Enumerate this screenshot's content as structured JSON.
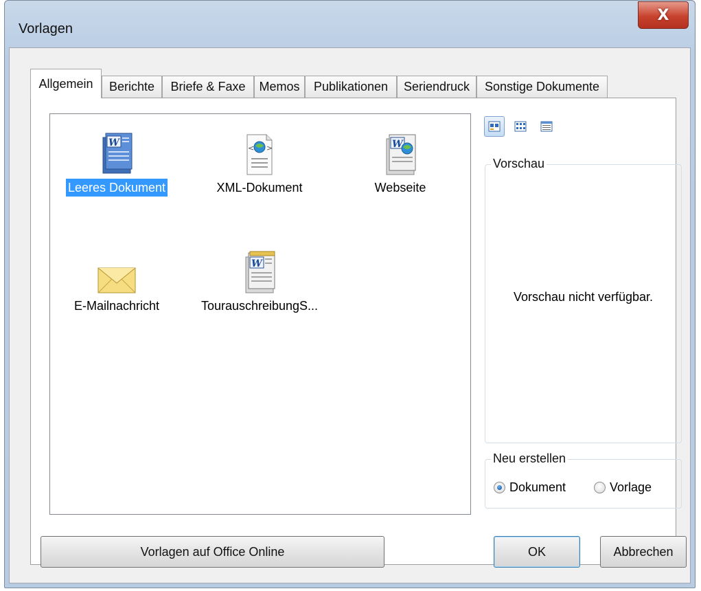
{
  "window": {
    "title": "Vorlagen",
    "close_glyph": "X"
  },
  "tabs": [
    {
      "label": "Allgemein",
      "active": true
    },
    {
      "label": "Berichte"
    },
    {
      "label": "Briefe & Faxe"
    },
    {
      "label": "Memos"
    },
    {
      "label": "Publikationen"
    },
    {
      "label": "Seriendruck"
    },
    {
      "label": "Sonstige Dokumente"
    }
  ],
  "templates": [
    {
      "label": "Leeres Dokument",
      "icon": "word-document-icon",
      "selected": true
    },
    {
      "label": "XML-Dokument",
      "icon": "xml-document-icon"
    },
    {
      "label": "Webseite",
      "icon": "word-webpage-icon"
    },
    {
      "label": "E-Mailnachricht",
      "icon": "envelope-icon"
    },
    {
      "label": "TourauschreibungS...",
      "icon": "word-template-icon"
    }
  ],
  "view_buttons": [
    {
      "icon": "large-icons-view-icon",
      "active": true
    },
    {
      "icon": "list-view-icon"
    },
    {
      "icon": "details-view-icon"
    }
  ],
  "preview": {
    "title": "Vorschau",
    "message": "Vorschau nicht verfügbar."
  },
  "create_new": {
    "title": "Neu erstellen",
    "options": [
      {
        "label": "Dokument",
        "checked": true
      },
      {
        "label": "Vorlage",
        "checked": false
      }
    ]
  },
  "buttons": {
    "office_online": "Vorlagen auf Office Online",
    "ok": "OK",
    "cancel": "Abbrechen"
  }
}
